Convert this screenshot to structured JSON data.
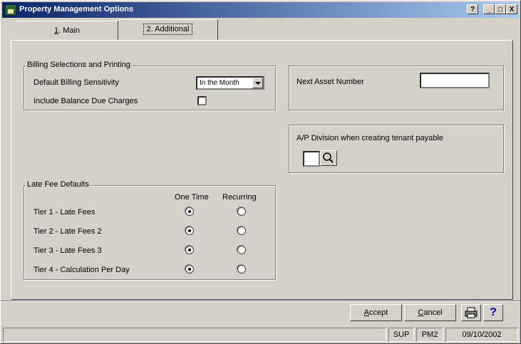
{
  "window": {
    "title": "Property Management Options"
  },
  "title_buttons": {
    "help": "?",
    "minimize": "_",
    "maximize": "□",
    "close": "X"
  },
  "tabs": [
    {
      "accel": "1",
      "label": ". Main"
    },
    {
      "accel": "2",
      "label": ". Additional"
    }
  ],
  "billing": {
    "group_label": "Billing Selections and Printing",
    "sensitivity_label": "Default Billing Sensitivity",
    "sensitivity_value": "In the Month",
    "balance_label": "Include Balance Due Charges",
    "balance_checked": false
  },
  "next_asset": {
    "label": "Next Asset Number",
    "value": ""
  },
  "ap_division": {
    "label": "A/P Division when creating tenant payable",
    "value": ""
  },
  "late_fee": {
    "group_label": "Late Fee Defaults",
    "col_one_time": "One Time",
    "col_recurring": "Recurring",
    "rows": [
      {
        "label": "Tier 1 - Late Fees",
        "selected": "one_time"
      },
      {
        "label": "Tier 2 - Late Fees 2",
        "selected": "one_time"
      },
      {
        "label": "Tier 3 - Late Fees 3",
        "selected": "one_time"
      },
      {
        "label": "Tier 4 - Calculation Per Day",
        "selected": "one_time"
      }
    ]
  },
  "buttons": {
    "accept_accel": "A",
    "accept_rest": "ccept",
    "cancel_accel": "C",
    "cancel_rest": "ancel",
    "help": "?"
  },
  "statusbar": {
    "user": "SUP",
    "company": "PM2",
    "date": "09/10/2002"
  }
}
